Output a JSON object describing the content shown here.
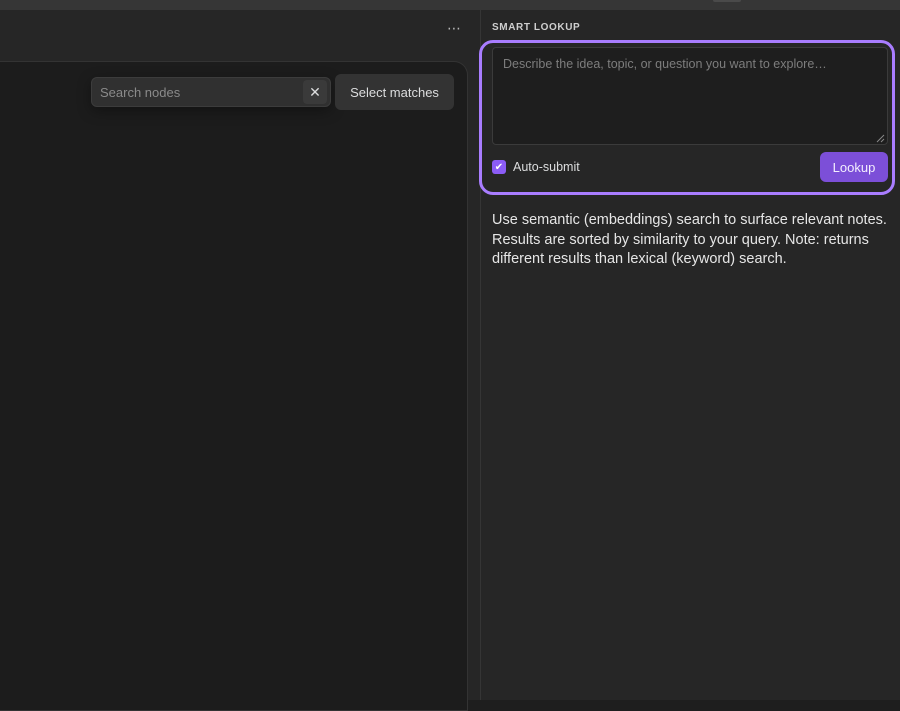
{
  "toolbar": {
    "more_icon": "ellipsis-icon",
    "more_glyph": "⋯"
  },
  "graph": {
    "search_placeholder": "Search nodes",
    "search_value": "",
    "clear_glyph": "✕",
    "select_matches_label": "Select matches"
  },
  "smart_lookup": {
    "title": "SMART LOOKUP",
    "query_placeholder": "Describe the idea, topic, or question you want to explore…",
    "query_value": "",
    "auto_submit_label": "Auto-submit",
    "auto_submit_checked": true,
    "check_glyph": "✔",
    "lookup_label": "Lookup",
    "description": "Use semantic (embeddings) search to surface relevant notes. Results are sorted by similarity to your query. Note: returns different results than lexical (keyword) search."
  },
  "colors": {
    "accent": "#a97dff",
    "button": "#7c4fd8",
    "checkbox": "#8b5cf6"
  }
}
